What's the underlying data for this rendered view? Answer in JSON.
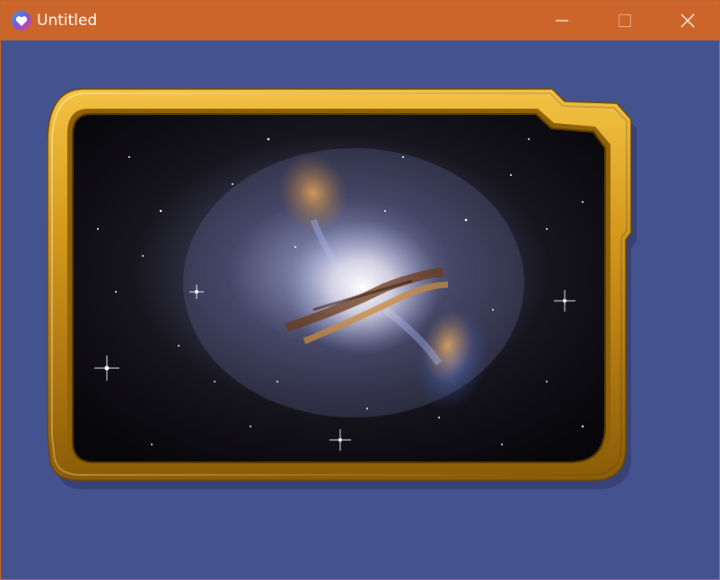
{
  "window": {
    "title": "Untitled",
    "app_icon": "heart-app-icon",
    "controls": [
      "minimize-icon",
      "maximize-icon",
      "close-icon"
    ]
  },
  "colors": {
    "titlebar": "#cc6529",
    "background": "#455290",
    "frame_gold": "#d79b1c"
  },
  "content": {
    "image": "galaxy-photo",
    "frame": "gold-bezel-frame"
  }
}
